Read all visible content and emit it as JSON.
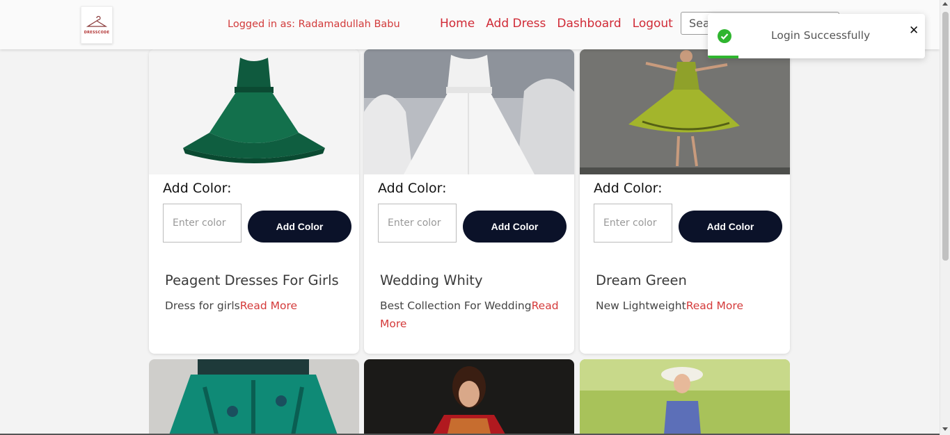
{
  "header": {
    "logo_text": "DRESSCODE",
    "logged_in_text": "Logged in as: Radamadullah Babu",
    "nav": [
      "Home",
      "Add Dress",
      "Dashboard",
      "Logout"
    ],
    "search_placeholder": "Search"
  },
  "cards": [
    {
      "image": "green-tiered-girls-dress",
      "color_label": "Add Color:",
      "color_placeholder": "Enter color",
      "button_label": "Add Color",
      "title": "Peagent Dresses For Girls",
      "description": "Dress for girls",
      "read_more": "Read More"
    },
    {
      "image": "white-wedding-gowns",
      "color_label": "Add Color:",
      "color_placeholder": "Enter color",
      "button_label": "Add Color",
      "title": "Wedding Whity",
      "description": "Best Collection For Wedding",
      "read_more": "Read More"
    },
    {
      "image": "green-floral-dress-model",
      "color_label": "Add Color:",
      "color_placeholder": "Enter color",
      "button_label": "Add Color",
      "title": "Dream Green",
      "description": "New Lightweight",
      "read_more": "Read More"
    }
  ],
  "row2_images": [
    "teal-floral-skirt",
    "red-bridal-lehenga",
    "woman-in-hat-on-grass"
  ],
  "toast": {
    "message": "Login Successfully",
    "close": "✕",
    "progress": 0.14
  },
  "colors": {
    "accent_red": "#d02a36",
    "button_navy": "#0b1229",
    "success_green": "#2fb52f"
  }
}
